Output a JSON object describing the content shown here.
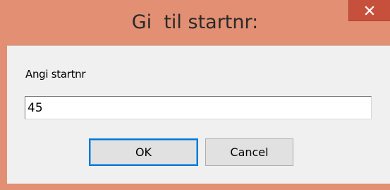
{
  "window": {
    "title": "Gi  til startnr:"
  },
  "titlebar": {
    "close_icon": "close-icon"
  },
  "form": {
    "label": "Angi startnr",
    "input_value": "45"
  },
  "buttons": {
    "ok_label": "OK",
    "cancel_label": "Cancel"
  },
  "colors": {
    "frame": "#e28f73",
    "close_button": "#c7503c",
    "client_background": "#f0f0f0",
    "default_button_border": "#0078d7"
  }
}
